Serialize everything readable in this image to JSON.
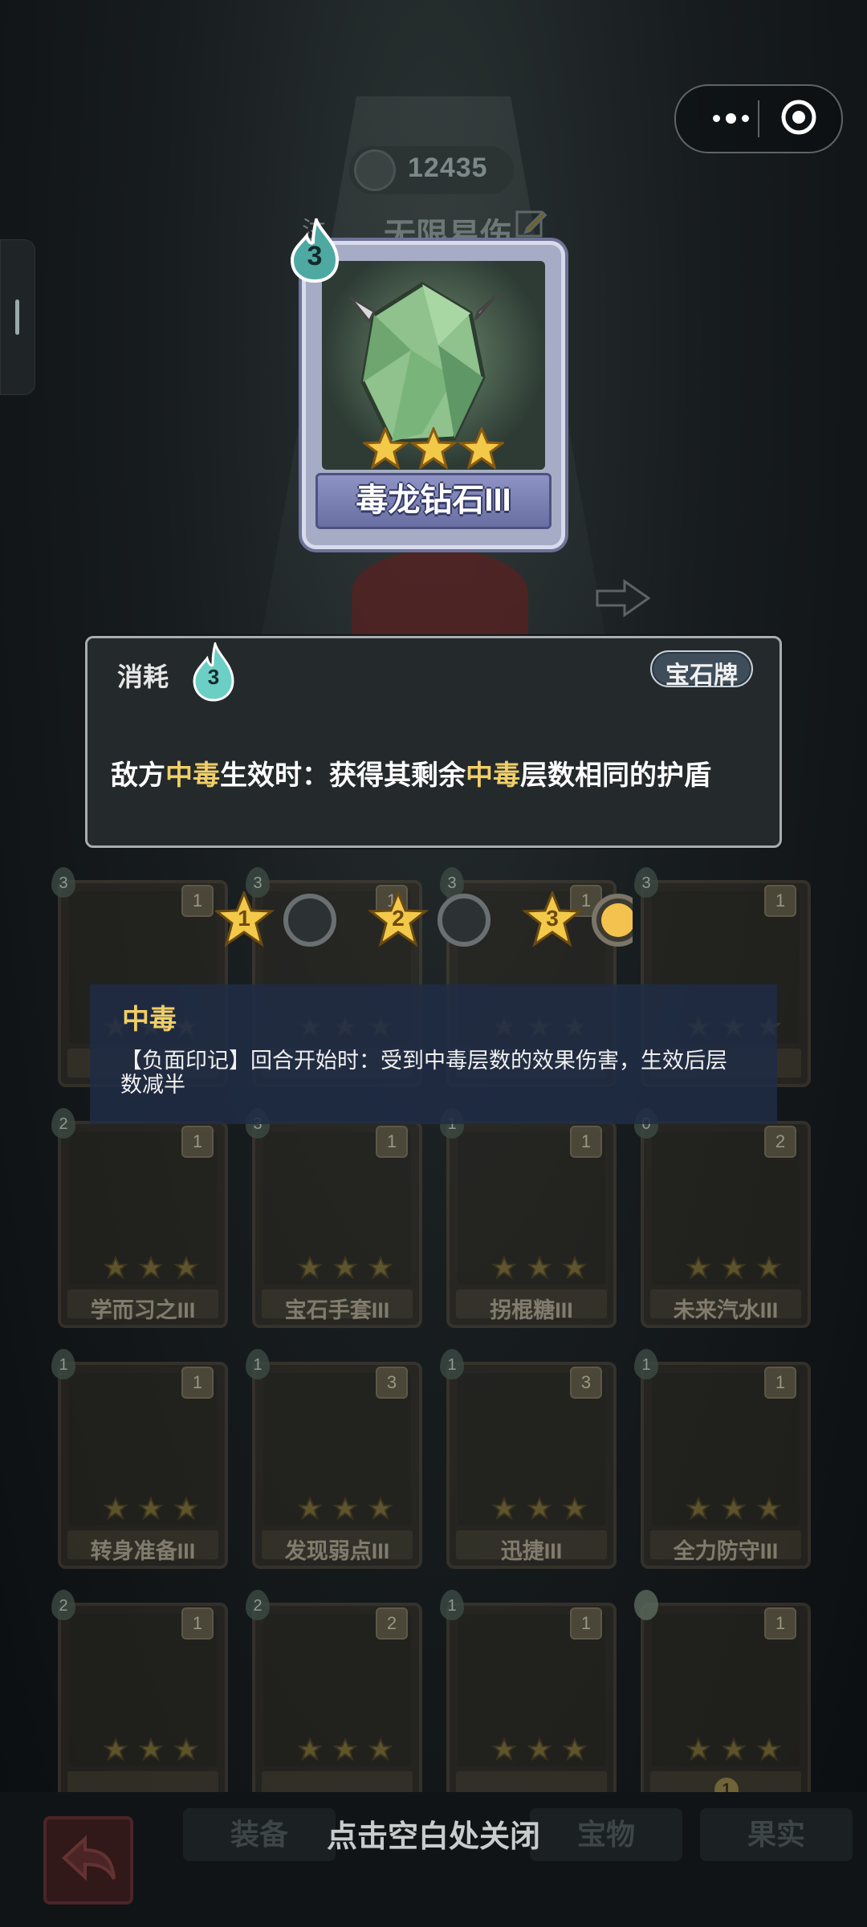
{
  "header": {
    "gold_value": "12435",
    "enemy_title": "无限易伤",
    "enemy_prefix": "注"
  },
  "selected_card": {
    "name": "毒龙钻石III",
    "cost": "3",
    "stars": 3
  },
  "tooltip": {
    "cost_label": "消耗",
    "cost_value": "3",
    "type_tag": "宝石牌",
    "desc_part1": "敌方",
    "desc_kw1": "中毒",
    "desc_part2": "生效时：获得其剩余",
    "desc_kw2": "中毒",
    "desc_part3": "层数相同的护盾"
  },
  "star_progress": {
    "levels": [
      "1",
      "2",
      "3"
    ],
    "filled": 1,
    "total": 3
  },
  "keyword_tip": {
    "title": "中毒",
    "body": "【负面印记】回合开始时：受到中毒层数的效果伤害，生效后层数减半"
  },
  "deck": {
    "row1": [
      {
        "cost": "3",
        "count": "1"
      },
      {
        "cost": "3",
        "count": "1"
      },
      {
        "cost": "3",
        "count": "1"
      },
      {
        "cost": "3",
        "count": "1"
      }
    ],
    "row2": [
      {
        "name": "学而习之III",
        "cost": "2",
        "count": "1"
      },
      {
        "name": "宝石手套III",
        "cost": "3",
        "count": "1"
      },
      {
        "name": "拐棍糖III",
        "cost": "1",
        "count": "1"
      },
      {
        "name": "未来汽水III",
        "cost": "0",
        "count": "2"
      }
    ],
    "row3": [
      {
        "name": "转身准备III",
        "cost": "1",
        "count": "1"
      },
      {
        "name": "发现弱点III",
        "cost": "1",
        "count": "3"
      },
      {
        "name": "迅捷III",
        "cost": "1",
        "count": "3"
      },
      {
        "name": "全力防守III",
        "cost": "1",
        "count": "1"
      }
    ],
    "row4": [
      {
        "cost": "2",
        "count": "1"
      },
      {
        "cost": "2",
        "count": "2"
      },
      {
        "cost": "1",
        "count": "1"
      },
      {
        "cost": "",
        "count": "1",
        "level": "1"
      }
    ]
  },
  "bottom_tabs": {
    "tab1": "装备",
    "tab2": "宝物",
    "tab3": "果实",
    "close_hint": "点击空白处关闭"
  },
  "colors": {
    "keyword": "#f1cf67",
    "panel_bg": "#24292b",
    "card_frame": "#a7acc6",
    "poison_tip_bg": "#202c46"
  }
}
